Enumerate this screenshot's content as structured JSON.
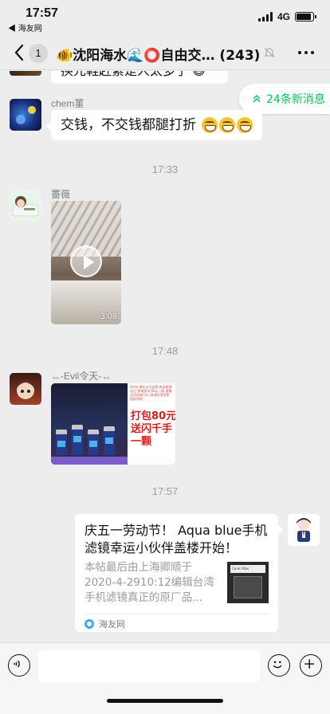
{
  "status_bar": {
    "time": "17:57",
    "back_app": "◀ 海友网",
    "network": "4G",
    "signal_icon": "signal-bars-icon",
    "battery_icon": "battery-icon",
    "battery_level": 0.9
  },
  "nav": {
    "back_icon": "chevron-left-icon",
    "unread_count": "1",
    "title": "🐠沈阳海水🌊⭕自由交… (243)",
    "mute_icon": "mute-bell-icon",
    "more_icon": "more-dots-icon"
  },
  "new_messages": {
    "label": "24条新消息",
    "icon": "double-chevron-up-icon",
    "color": "#07c160"
  },
  "messages": {
    "partial_text": "换元鞋赶紧是人太多了 😆",
    "m1": {
      "sender": "chem菫",
      "text": "交钱，不交钱都腿打折"
    },
    "ts1": "17:33",
    "m2": {
      "sender": "薔薇",
      "video_duration": "3:08"
    },
    "ts2": "17:48",
    "m3": {
      "sender": "↔-Evil令天-↔",
      "image_fine_print": "Hello 请在以下这里 有没有测试过 快来测试 5kg 一瓶 直接点击进来可以 测试好用还是 很好用的",
      "image_promo": [
        "打包80元",
        "送闪千手",
        "一颗"
      ]
    },
    "ts3": "17:57",
    "m4": {
      "title": "庆五一劳动节！ Aqua blue手机滤镜幸运小伙伴盖楼开始！",
      "description": "本帖最后由上海卿顺于2020-4-2910:12编辑台湾手机滤镜真正的原厂品...",
      "thumb_label": "Coral Filter",
      "source": "海友网"
    }
  },
  "input_bar": {
    "voice_icon": "voice-icon",
    "emoji_icon": "emoji-icon",
    "plus_icon": "plus-icon"
  }
}
